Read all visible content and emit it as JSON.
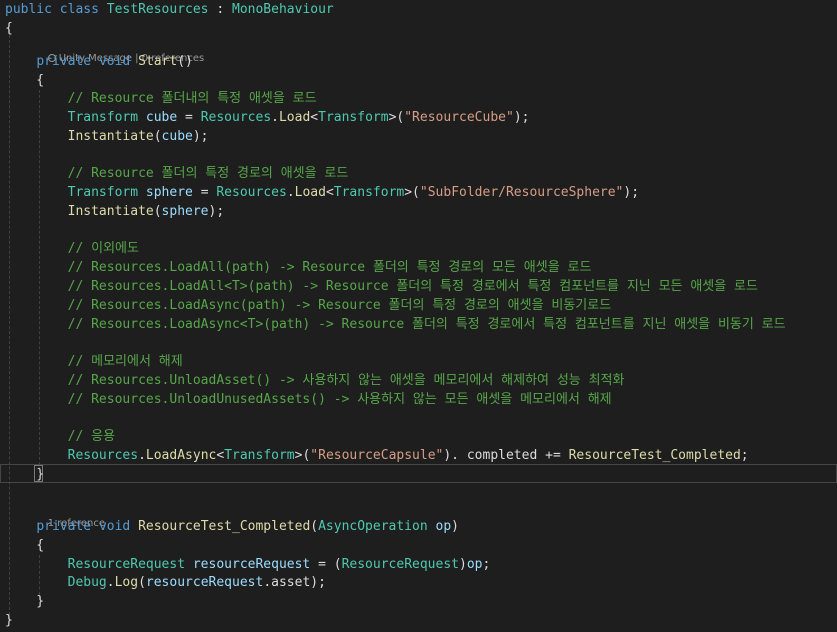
{
  "editor": {
    "language": "csharp",
    "theme_colors": {
      "background": "#1e1e1e",
      "keyword": "#569cd6",
      "type": "#4ec9b0",
      "method": "#dcdcaa",
      "variable": "#9cdcfe",
      "string": "#d69d85",
      "comment": "#57a64a",
      "text": "#dcdcdc",
      "codelens": "#999999"
    },
    "codelens": {
      "start": "Unity Message | 0 references",
      "completed": "1 reference"
    },
    "lines": [
      [
        [
          "kw",
          "public"
        ],
        [
          "pl",
          " "
        ],
        [
          "kw",
          "class"
        ],
        [
          "pl",
          " "
        ],
        [
          "ty",
          "TestResources"
        ],
        [
          "pl",
          " : "
        ],
        [
          "ty",
          "MonoBehaviour"
        ]
      ],
      [
        [
          "pl",
          "{"
        ]
      ],
      [
        [
          "pl",
          "    "
        ],
        [
          "kw",
          "private"
        ],
        [
          "pl",
          " "
        ],
        [
          "kw",
          "void"
        ],
        [
          "pl",
          " "
        ],
        [
          "fn",
          "Start"
        ],
        [
          "pl",
          "()"
        ]
      ],
      [
        [
          "pl",
          "    {"
        ]
      ],
      [
        [
          "pl",
          "        "
        ],
        [
          "cm",
          "// Resource 폴더내의 특정 애셋을 로드"
        ]
      ],
      [
        [
          "pl",
          "        "
        ],
        [
          "ty",
          "Transform"
        ],
        [
          "pl",
          " "
        ],
        [
          "vr",
          "cube"
        ],
        [
          "pl",
          " = "
        ],
        [
          "ty",
          "Resources"
        ],
        [
          "pl",
          "."
        ],
        [
          "fn",
          "Load"
        ],
        [
          "pl",
          "<"
        ],
        [
          "ty",
          "Transform"
        ],
        [
          "pl",
          ">("
        ],
        [
          "st",
          "\"ResourceCube\""
        ],
        [
          "pl",
          ");"
        ]
      ],
      [
        [
          "pl",
          "        "
        ],
        [
          "fn",
          "Instantiate"
        ],
        [
          "pl",
          "("
        ],
        [
          "vr",
          "cube"
        ],
        [
          "pl",
          ");"
        ]
      ],
      [
        [
          "pl",
          ""
        ]
      ],
      [
        [
          "pl",
          "        "
        ],
        [
          "cm",
          "// Resource 폴더의 특정 경로의 애셋을 로드"
        ]
      ],
      [
        [
          "pl",
          "        "
        ],
        [
          "ty",
          "Transform"
        ],
        [
          "pl",
          " "
        ],
        [
          "vr",
          "sphere"
        ],
        [
          "pl",
          " = "
        ],
        [
          "ty",
          "Resources"
        ],
        [
          "pl",
          "."
        ],
        [
          "fn",
          "Load"
        ],
        [
          "pl",
          "<"
        ],
        [
          "ty",
          "Transform"
        ],
        [
          "pl",
          ">("
        ],
        [
          "st",
          "\"SubFolder/ResourceSphere\""
        ],
        [
          "pl",
          ");"
        ]
      ],
      [
        [
          "pl",
          "        "
        ],
        [
          "fn",
          "Instantiate"
        ],
        [
          "pl",
          "("
        ],
        [
          "vr",
          "sphere"
        ],
        [
          "pl",
          ");"
        ]
      ],
      [
        [
          "pl",
          ""
        ]
      ],
      [
        [
          "pl",
          "        "
        ],
        [
          "cm",
          "// 이외에도"
        ]
      ],
      [
        [
          "pl",
          "        "
        ],
        [
          "cm",
          "// Resources.LoadAll(path) -> Resource 폴더의 특정 경로의 모든 애셋을 로드"
        ]
      ],
      [
        [
          "pl",
          "        "
        ],
        [
          "cm",
          "// Resources.LoadAll<T>(path) -> Resource 폴더의 특정 경로에서 특정 컴포넌트를 지닌 모든 애셋을 로드"
        ]
      ],
      [
        [
          "pl",
          "        "
        ],
        [
          "cm",
          "// Resources.LoadAsync(path) -> Resource 폴더의 특정 경로의 애셋을 비동기로드"
        ]
      ],
      [
        [
          "pl",
          "        "
        ],
        [
          "cm",
          "// Resources.LoadAsync<T>(path) -> Resource 폴더의 특정 경로에서 특정 컴포넌트를 지닌 애셋을 비동기 로드"
        ]
      ],
      [
        [
          "pl",
          ""
        ]
      ],
      [
        [
          "pl",
          "        "
        ],
        [
          "cm",
          "// 메모리에서 해제"
        ]
      ],
      [
        [
          "pl",
          "        "
        ],
        [
          "cm",
          "// Resources.UnloadAsset() -> 사용하지 않는 애셋을 메모리에서 해제하여 성능 최적화"
        ]
      ],
      [
        [
          "pl",
          "        "
        ],
        [
          "cm",
          "// Resources.UnloadUnusedAssets() -> 사용하지 않는 모든 애셋을 메모리에서 해제"
        ]
      ],
      [
        [
          "pl",
          ""
        ]
      ],
      [
        [
          "pl",
          "        "
        ],
        [
          "cm",
          "// 응용"
        ]
      ],
      [
        [
          "pl",
          "        "
        ],
        [
          "ty",
          "Resources"
        ],
        [
          "pl",
          "."
        ],
        [
          "fn",
          "LoadAsync"
        ],
        [
          "pl",
          "<"
        ],
        [
          "ty",
          "Transform"
        ],
        [
          "pl",
          ">("
        ],
        [
          "st",
          "\"ResourceCapsule\""
        ],
        [
          "pl",
          "). "
        ],
        [
          "pl",
          "completed"
        ],
        [
          "pl",
          " += "
        ],
        [
          "fn",
          "ResourceTest_Completed"
        ],
        [
          "pl",
          ";"
        ]
      ],
      [
        [
          "pl",
          "    }"
        ]
      ],
      [
        [
          "pl",
          ""
        ]
      ],
      [
        [
          "pl",
          "    "
        ],
        [
          "kw",
          "private"
        ],
        [
          "pl",
          " "
        ],
        [
          "kw",
          "void"
        ],
        [
          "pl",
          " "
        ],
        [
          "fn",
          "ResourceTest_Completed"
        ],
        [
          "pl",
          "("
        ],
        [
          "ty",
          "AsyncOperation"
        ],
        [
          "pl",
          " "
        ],
        [
          "vr",
          "op"
        ],
        [
          "pl",
          ")"
        ]
      ],
      [
        [
          "pl",
          "    {"
        ]
      ],
      [
        [
          "pl",
          "        "
        ],
        [
          "ty",
          "ResourceRequest"
        ],
        [
          "pl",
          " "
        ],
        [
          "vr",
          "resourceRequest"
        ],
        [
          "pl",
          " = ("
        ],
        [
          "ty",
          "ResourceRequest"
        ],
        [
          "pl",
          ")"
        ],
        [
          "vr",
          "op"
        ],
        [
          "pl",
          ";"
        ]
      ],
      [
        [
          "pl",
          "        "
        ],
        [
          "ty",
          "Debug"
        ],
        [
          "pl",
          "."
        ],
        [
          "fn",
          "Log"
        ],
        [
          "pl",
          "("
        ],
        [
          "vr",
          "resourceRequest"
        ],
        [
          "pl",
          "."
        ],
        [
          "pl",
          "asset"
        ],
        [
          "pl",
          ");"
        ]
      ],
      [
        [
          "pl",
          "    }"
        ]
      ],
      [
        [
          "pl",
          "}"
        ]
      ]
    ]
  }
}
